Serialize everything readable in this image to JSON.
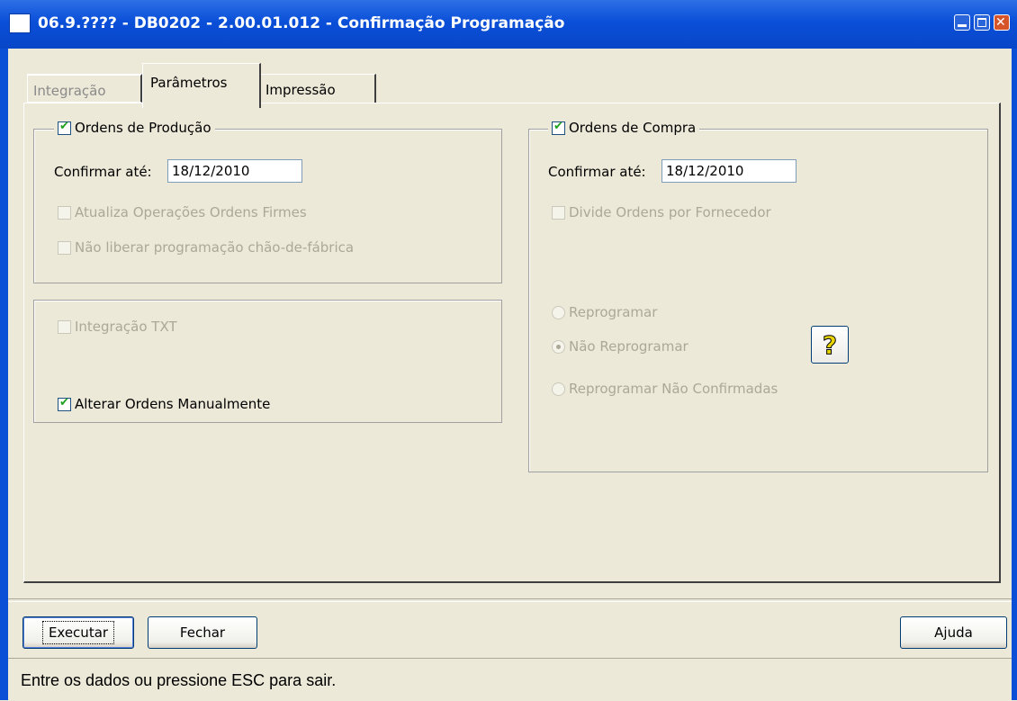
{
  "window": {
    "title": "06.9.???? - DB0202 - 2.00.01.012 - Confirmação Programação"
  },
  "tabs": [
    {
      "label": "Integração",
      "enabled": false
    },
    {
      "label": "Parâmetros",
      "active": true
    },
    {
      "label": "Impressão"
    }
  ],
  "producao": {
    "title": "Ordens de Produção",
    "checked": true,
    "confirm_label": "Confirmar até:",
    "confirm_value": "18/12/2010",
    "opt1": "Atualiza Operações Ordens Firmes",
    "opt2": "Não liberar programação chão-de-fábrica"
  },
  "extra": {
    "integracao_txt": "Integração TXT",
    "alterar_ordens": "Alterar Ordens Manualmente"
  },
  "compra": {
    "title": "Ordens de Compra",
    "checked": true,
    "confirm_label": "Confirmar até:",
    "confirm_value": "18/12/2010",
    "divide": "Divide Ordens por Fornecedor",
    "radio": [
      "Reprogramar",
      "Não Reprogramar",
      "Reprogramar Não Confirmadas"
    ],
    "radio_selected": "Não Reprogramar"
  },
  "buttons": {
    "executar": "Executar",
    "fechar": "Fechar",
    "ajuda": "Ajuda"
  },
  "status": "Entre os dados ou pressione ESC para sair."
}
